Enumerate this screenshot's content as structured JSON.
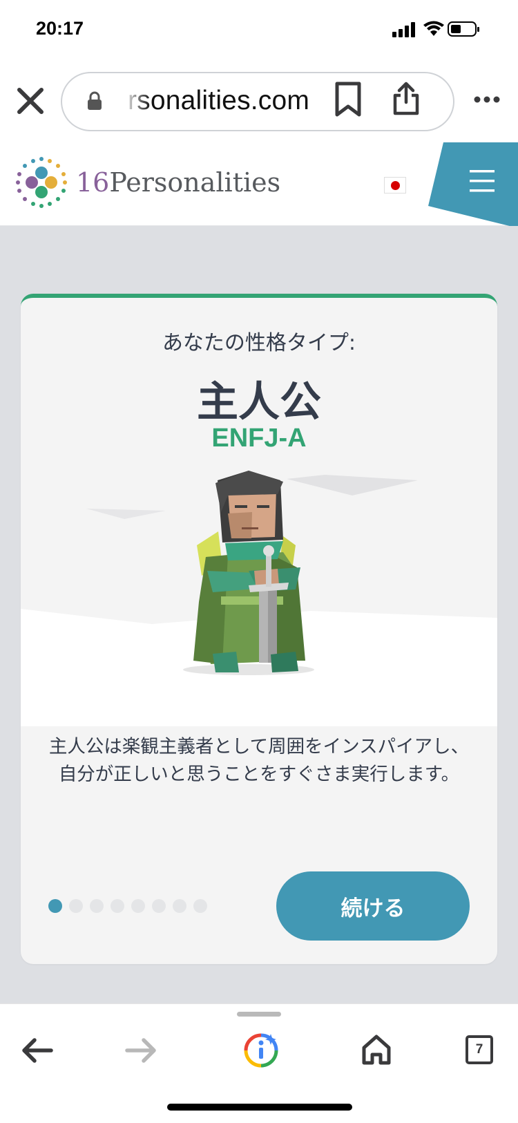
{
  "status_bar": {
    "time": "20:17"
  },
  "browser": {
    "url_text": "rsonalities.com"
  },
  "site": {
    "logo_number": "16",
    "logo_name": "Personalities",
    "language_flag": "jp"
  },
  "card": {
    "subtitle": "あなたの性格タイプ:",
    "title": "主人公",
    "code": "ENFJ-A",
    "description": "主人公は楽観主義者として周囲をインスパイアし、自分が正しいと思うことをすぐさま実行します。",
    "continue_label": "続ける",
    "page_total": 8,
    "page_current": 1
  },
  "toolbar": {
    "tab_count": "7"
  },
  "colors": {
    "accent_green": "#33a474",
    "accent_blue": "#4298b4",
    "text": "#343c4b"
  }
}
